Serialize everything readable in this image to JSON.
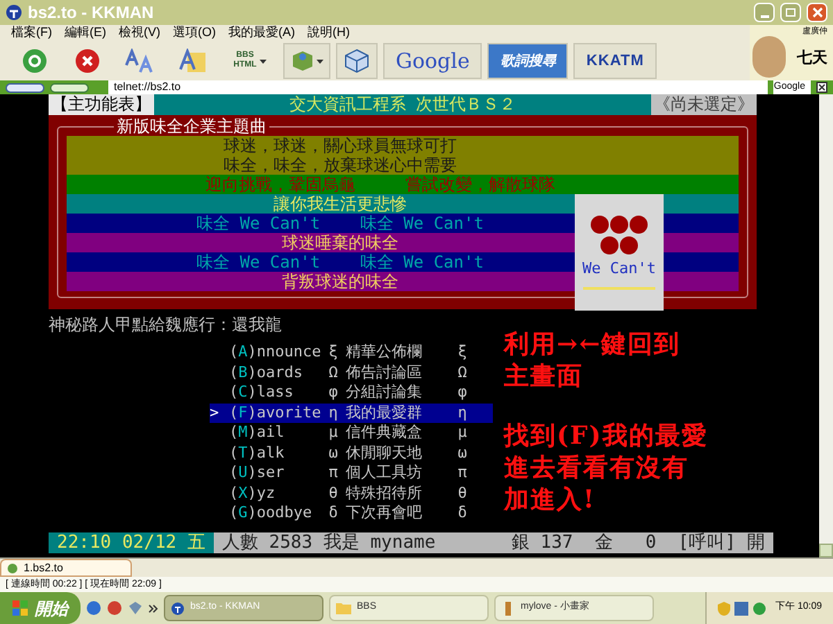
{
  "window": {
    "title": "bs2.to - KKMAN"
  },
  "menu": [
    "檔案(F)",
    "編輯(E)",
    "檢視(V)",
    "選項(O)",
    "我的最愛(A)",
    "說明(H)"
  ],
  "toolbar": [
    {
      "kind": "go"
    },
    {
      "kind": "stop"
    },
    {
      "kind": "font"
    },
    {
      "kind": "font-box"
    },
    {
      "kind": "bbs",
      "top": "BBS",
      "bottom": "HTML"
    },
    {
      "kind": "cube"
    },
    {
      "kind": "box"
    },
    {
      "kind": "google",
      "label": "Google"
    },
    {
      "kind": "lyrics",
      "label": "歌詞搜尋"
    },
    {
      "kind": "atm",
      "label": "KKATM"
    }
  ],
  "profile": {
    "name": "盧廣仲",
    "caption": "七天"
  },
  "address": {
    "value": "telnet://bs2.to",
    "engine": "Google"
  },
  "terminal": {
    "header": {
      "left": "【主功能表】",
      "center": "交大資訊工程系 次世代ＢＳ２",
      "right": "《尚未選定》"
    },
    "banner": {
      "title": "新版味全企業主題曲",
      "lines": [
        {
          "text": "球迷，球迷，關心球員無球可打",
          "kind": "olive"
        },
        {
          "text": "味全，味全，放棄球迷心中需要",
          "kind": "olive"
        },
        {
          "text": "迎向挑戰，鞏固烏龜　　　嘗試改變，解散球隊",
          "kind": "green"
        },
        {
          "text": "讓你我生活更悲慘",
          "kind": "teal"
        },
        {
          "text": "味全 We Can't    味全 We Can't",
          "kind": "navy"
        },
        {
          "text": "球迷唾棄的味全",
          "kind": "purple"
        },
        {
          "text": "味全 We Can't    味全 We Can't",
          "kind": "navy"
        },
        {
          "text": "背叛球迷的味全",
          "kind": "purple"
        }
      ],
      "card": {
        "caption": "We Can't"
      }
    },
    "notice": "神秘路人甲點給魏應行：還我龍",
    "cursor": ">",
    "items": [
      {
        "open": "(",
        "key": "A",
        "rest": ")nnounce",
        "symbol": "ξ",
        "label": "精華公佈欄",
        "symbol_right": "ξ",
        "selected": false
      },
      {
        "open": "(",
        "key": "B",
        "rest": ")oards",
        "symbol": "Ω",
        "label": "佈告討論區",
        "symbol_right": "Ω",
        "selected": false
      },
      {
        "open": "(",
        "key": "C",
        "rest": ")lass",
        "symbol": "φ",
        "label": "分組討論集",
        "symbol_right": "φ",
        "selected": false
      },
      {
        "open": "(",
        "key": "F",
        "rest": ")avorite",
        "symbol": "η",
        "label": "我的最愛群",
        "symbol_right": "η",
        "selected": true
      },
      {
        "open": "(",
        "key": "M",
        "rest": ")ail",
        "symbol": "μ",
        "label": "信件典藏盒",
        "symbol_right": "μ",
        "selected": false
      },
      {
        "open": "(",
        "key": "T",
        "rest": ")alk",
        "symbol": "ω",
        "label": "休閒聊天地",
        "symbol_right": "ω",
        "selected": false
      },
      {
        "open": "(",
        "key": "U",
        "rest": ")ser",
        "symbol": "π",
        "label": "個人工具坊",
        "symbol_right": "π",
        "selected": false
      },
      {
        "open": "(",
        "key": "X",
        "rest": ")yz",
        "symbol": "θ",
        "label": "特殊招待所",
        "symbol_right": "θ",
        "selected": false
      },
      {
        "open": "(",
        "key": "G",
        "rest": ")oodbye",
        "symbol": "δ",
        "label": "下次再會吧",
        "symbol_right": "δ",
        "selected": false
      }
    ],
    "annotations": [
      [
        "利用→←鍵回到",
        "主畫面"
      ],
      [
        "找到(F)我的最愛",
        "進去看看有沒有",
        "加進入!"
      ]
    ],
    "status": {
      "clock": "22:10 02/12 五",
      "info": "人數 2583 我是 myname       銀 137  金   0  [呼叫] 開"
    }
  },
  "tabs": [
    {
      "label": "1.bs2.to",
      "selected": true
    }
  ],
  "status_bar": "[ 連線時間 00:22 ] [ 現在時間 22:09 ]",
  "taskbar": {
    "start": "開始",
    "tasks": [
      {
        "label": "bs2.to - KKMAN",
        "kind": "browser",
        "selected": true
      },
      {
        "label": "BBS",
        "kind": "folder",
        "selected": false
      },
      {
        "label": "mylove - 小畫家",
        "kind": "paint",
        "selected": false
      }
    ],
    "clock": "下午 10:09"
  }
}
